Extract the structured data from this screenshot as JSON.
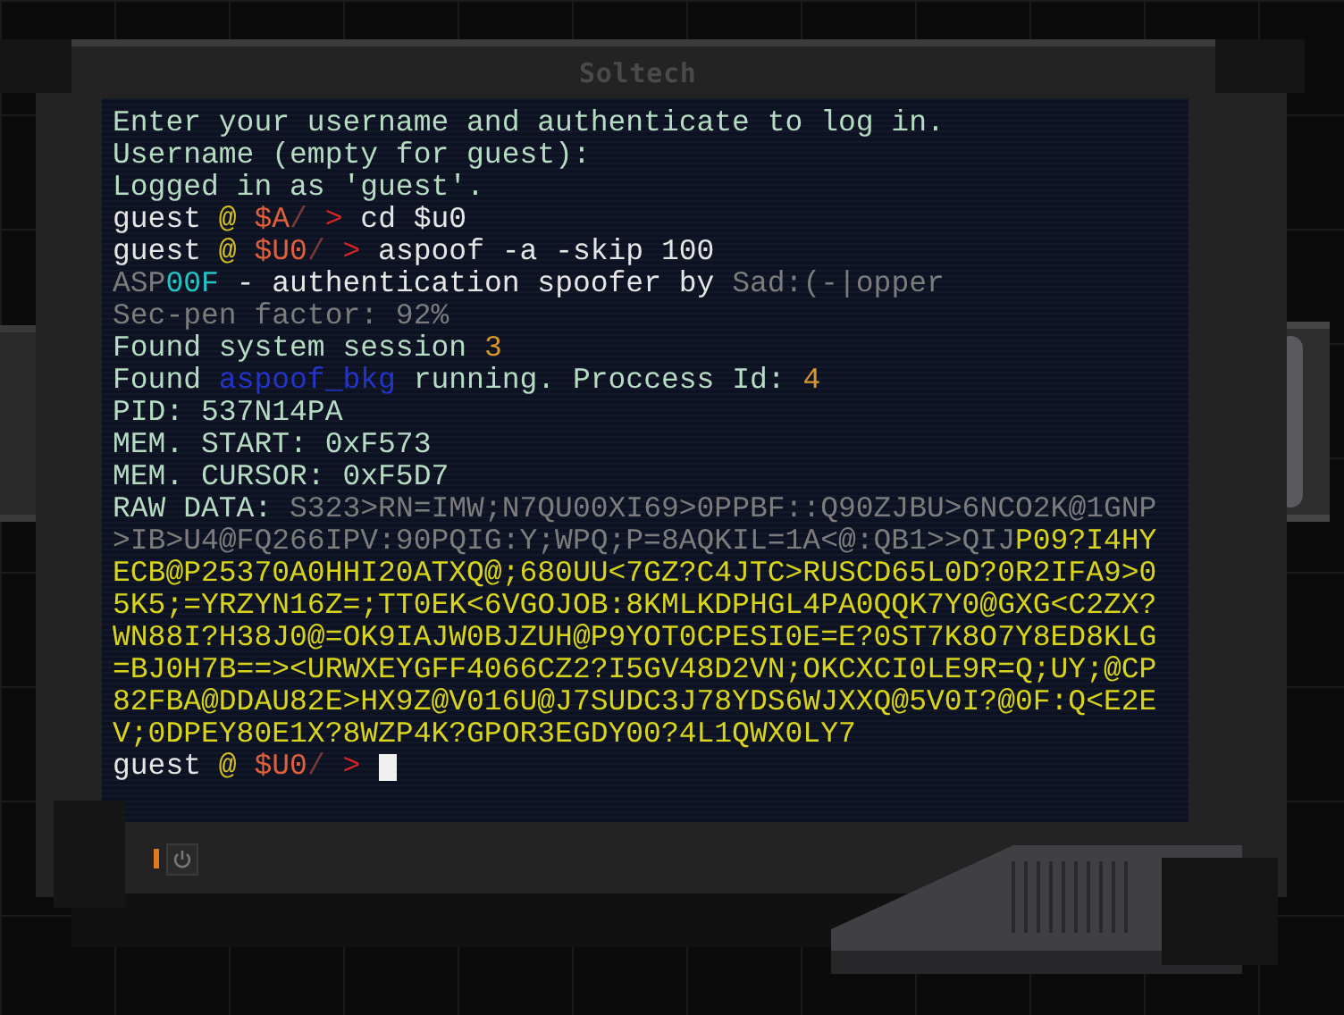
{
  "device": {
    "brand": "Soltech"
  },
  "terminal": {
    "lines": [
      {
        "segments": [
          {
            "kind": "text",
            "text": "Enter your username and authenticate to log in."
          }
        ]
      },
      {
        "segments": [
          {
            "kind": "text",
            "text": "Username (empty for guest):"
          }
        ]
      },
      {
        "segments": [
          {
            "kind": "text",
            "text": "Logged in as 'guest'."
          }
        ]
      },
      {
        "segments": [
          {
            "kind": "cmd",
            "text": "guest "
          },
          {
            "kind": "at",
            "text": "@"
          },
          {
            "kind": "path",
            "text": " $A"
          },
          {
            "kind": "slash",
            "text": "/"
          },
          {
            "kind": "arrow",
            "text": " >"
          },
          {
            "kind": "cmd",
            "text": " cd $u0"
          }
        ]
      },
      {
        "segments": [
          {
            "kind": "cmd",
            "text": "guest "
          },
          {
            "kind": "at",
            "text": "@"
          },
          {
            "kind": "path",
            "text": " $U0"
          },
          {
            "kind": "slash",
            "text": "/"
          },
          {
            "kind": "arrow",
            "text": " >"
          },
          {
            "kind": "cmd",
            "text": " aspoof -a -skip 100"
          }
        ]
      },
      {
        "segments": [
          {
            "kind": "dim",
            "text": "ASP"
          },
          {
            "kind": "cyan",
            "text": "00F"
          },
          {
            "kind": "cmd",
            "text": " - authentication spoofer by "
          },
          {
            "kind": "dim",
            "text": "Sad:(-|opper"
          }
        ]
      },
      {
        "segments": [
          {
            "kind": "dim",
            "text": "Sec-pen factor: 92%"
          }
        ]
      },
      {
        "segments": [
          {
            "kind": "text",
            "text": "Found system session "
          },
          {
            "kind": "num",
            "text": "3"
          }
        ]
      },
      {
        "segments": [
          {
            "kind": "text",
            "text": "Found "
          },
          {
            "kind": "link",
            "text": "aspoof_bkg"
          },
          {
            "kind": "text",
            "text": " running. Proccess Id: "
          },
          {
            "kind": "num",
            "text": "4"
          }
        ]
      },
      {
        "segments": [
          {
            "kind": "text",
            "text": "PID: 537N14PA"
          }
        ]
      },
      {
        "segments": [
          {
            "kind": "text",
            "text": "MEM. START: 0xF573"
          }
        ]
      },
      {
        "segments": [
          {
            "kind": "text",
            "text": "MEM. CURSOR: 0xF5D7"
          }
        ]
      },
      {
        "segments": [
          {
            "kind": "text",
            "text": "RAW DATA: "
          },
          {
            "kind": "dim",
            "text": "S323>RN=IMW;N7QU00XI69>0PPBF::Q90ZJBU>6NCO2K@1GNP"
          }
        ]
      },
      {
        "segments": [
          {
            "kind": "dim",
            "text": ">IB>U4@FQ266IPV:90PQIG:Y;WPQ;P=8AQKIL=1A<@:QB1>>QIJ"
          },
          {
            "kind": "data",
            "text": "P09?I4HY"
          }
        ]
      },
      {
        "segments": [
          {
            "kind": "data",
            "text": "ECB@P25370A0HHI20ATXQ@;680UU<7GZ?C4JTC>RUSCD65L0D?0R2IFA9>0"
          }
        ]
      },
      {
        "segments": [
          {
            "kind": "data",
            "text": "5K5;=YRZYN16Z=;TT0EK<6VGOJOB:8KMLKDPHGL4PA0QQK7Y0@GXG<C2ZX?"
          }
        ]
      },
      {
        "segments": [
          {
            "kind": "data",
            "text": "WN88I?H38J0@=OK9IAJW0BJZUH@P9YOT0CPESI0E=E?0ST7K8O7Y8ED8KLG"
          }
        ]
      },
      {
        "segments": [
          {
            "kind": "data",
            "text": "=BJ0H7B==><URWXEYGFF4066CZ2?I5GV48D2VN;OKCXCI0LE9R=Q;UY;@CP"
          }
        ]
      },
      {
        "segments": [
          {
            "kind": "data",
            "text": "82FBA@DDAU82E>HX9Z@V016U@J7SUDC3J78YDS6WJXXQ@5V0I?@0F:Q<E2E"
          }
        ]
      },
      {
        "segments": [
          {
            "kind": "data",
            "text": "V;0DPEY80E1X?8WZP4K?GPOR3EGDY00?4L1QWX0LY7"
          }
        ]
      },
      {
        "segments": [
          {
            "kind": "cmd",
            "text": "guest "
          },
          {
            "kind": "at",
            "text": "@"
          },
          {
            "kind": "path",
            "text": " $U0"
          },
          {
            "kind": "slash",
            "text": "/"
          },
          {
            "kind": "arrow",
            "text": " > "
          }
        ],
        "cursor": true
      }
    ]
  }
}
